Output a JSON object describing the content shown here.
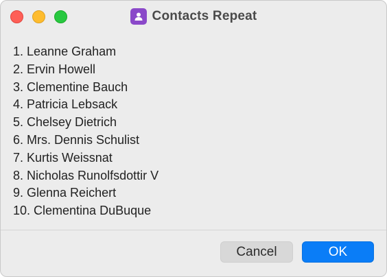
{
  "window": {
    "title": "Contacts Repeat",
    "app_icon": "person-icon"
  },
  "contacts": [
    "1. Leanne Graham",
    "2. Ervin Howell",
    "3. Clementine Bauch",
    "4. Patricia Lebsack",
    "5. Chelsey Dietrich",
    "6. Mrs. Dennis Schulist",
    "7. Kurtis Weissnat",
    "8. Nicholas Runolfsdottir V",
    "9. Glenna Reichert",
    "10. Clementina DuBuque"
  ],
  "buttons": {
    "cancel_label": "Cancel",
    "ok_label": "OK"
  },
  "colors": {
    "accent": "#0a7df7",
    "app_icon_bg": "#8a48c9",
    "close": "#fe5f57",
    "minimize": "#febc2e",
    "maximize": "#28c840"
  }
}
